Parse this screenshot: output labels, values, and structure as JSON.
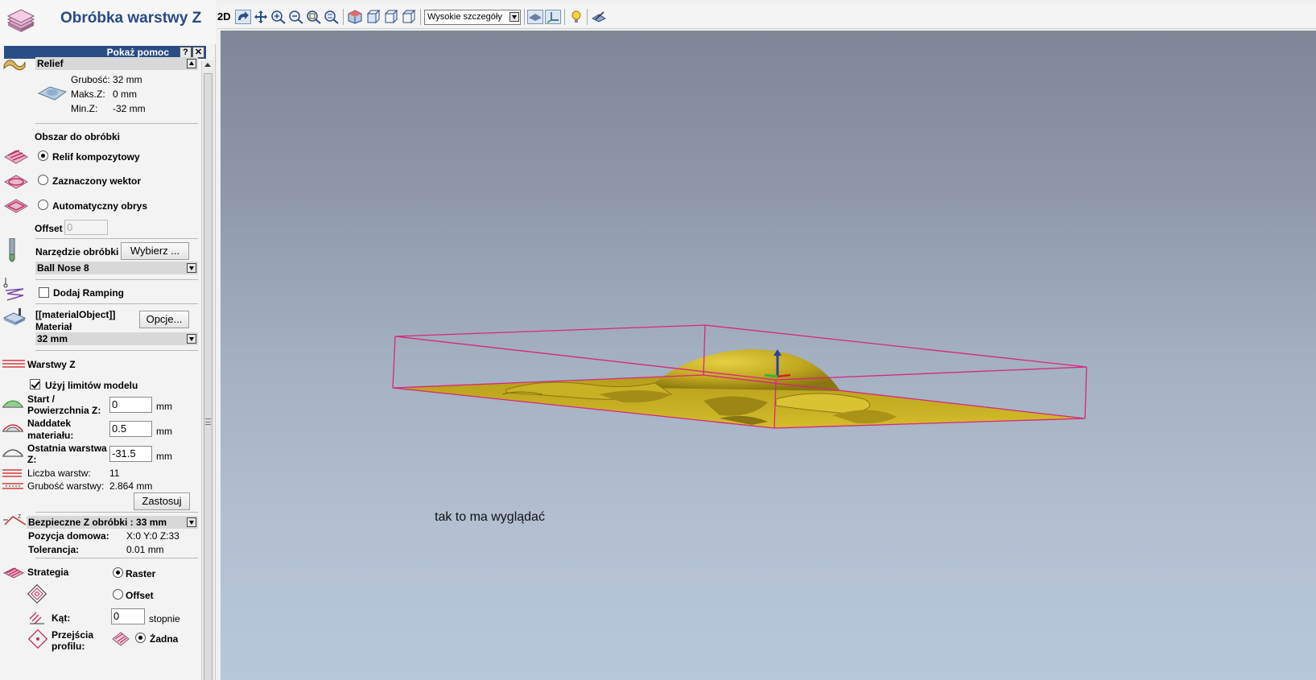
{
  "panel": {
    "title": "Obróbka warstwy Z",
    "help_label": "Pokaż pomoc",
    "help_btn": "?",
    "close_btn": "✕"
  },
  "relief": {
    "header": "Relief",
    "thickness_label": "Grubość:",
    "thickness_value": "32 mm",
    "maxz_label": "Maks.Z:",
    "maxz_value": "0 mm",
    "minz_label": "Min.Z:",
    "minz_value": "-32 mm"
  },
  "area": {
    "title": "Obszar do obróbki",
    "options": [
      "Relif kompozytowy",
      "Zaznaczony wektor",
      "Automatyczny obrys"
    ],
    "selected": 0,
    "offset_label": "Offset",
    "offset_value": "0"
  },
  "tool": {
    "label": "Narzędzie obróbki",
    "choose_btn": "Wybierz ...",
    "selected_tool": "Ball Nose 8"
  },
  "ramping": {
    "label": "Dodaj Ramping",
    "checked": false
  },
  "material": {
    "line1": "[[materialObject]]",
    "line2": "Materiał",
    "options_btn": "Opcje...",
    "value": "32 mm"
  },
  "zlayers": {
    "title": "Warstwy Z",
    "use_limits_label": "Użyj limitów modelu",
    "use_limits_checked": true,
    "start_label_1": "Start /",
    "start_label_2": "Powierzchnia Z:",
    "start_value": "0",
    "allowance_label_1": "Naddatek",
    "allowance_label_2": "materiału:",
    "allowance_value": "0.5",
    "last_label_1": "Ostatnia warstwa",
    "last_label_2": "Z:",
    "last_value": "-31.5",
    "unit": "mm",
    "count_label": "Liczba warstw:",
    "count_value": "11",
    "thick_label": "Grubość warstwy:",
    "thick_value": "2.864 mm",
    "apply_btn": "Zastosuj"
  },
  "safe": {
    "label": "Bezpieczne Z obróbki : 33 mm",
    "home_label": "Pozycja domowa:",
    "home_value": "X:0 Y:0 Z:33",
    "tol_label": "Tolerancja:",
    "tol_value": "0.01 mm"
  },
  "strategy": {
    "label": "Strategia",
    "raster": "Raster",
    "offset": "Offset",
    "selected": "Raster",
    "angle_label": "Kąt:",
    "angle_value": "0",
    "angle_unit": "stopnie",
    "passes_label_1": "Przejścia",
    "passes_label_2": "profilu:",
    "passes_option": "Żadna"
  },
  "toolbar": {
    "mode_2d": "2D",
    "detail_value": "Wysokie szczegóły"
  },
  "viewport": {
    "caption": "tak to ma wyglądać"
  },
  "colors": {
    "title_blue": "#2a4a86",
    "help_bar": "#2b4d85",
    "bbox_magenta": "#d8257f",
    "relief_gold": "#bfa61e"
  }
}
